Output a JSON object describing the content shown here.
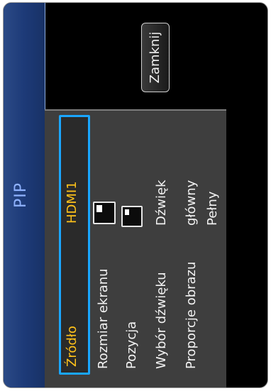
{
  "dialog": {
    "title": "PIP",
    "close_label": "Zamknij"
  },
  "settings": [
    {
      "label": "Źródło",
      "value": "HDMI1",
      "selected": true
    },
    {
      "label": "Rozmiar ekranu",
      "value": "",
      "icon": "pip-size-icon"
    },
    {
      "label": "Pozycja",
      "value": "",
      "icon": "pip-position-icon"
    },
    {
      "label": "Wybór dźwięku",
      "value": "Dźwięk"
    },
    {
      "label": "Proporcje obrazu",
      "value": "główny"
    },
    {
      "label": "",
      "value": "Pełny"
    }
  ],
  "colors": {
    "title": "#8fb2ff",
    "selection_border": "#1aa6ff",
    "selected_text": "#ffc21a",
    "titlebar": "#1d3a78"
  }
}
